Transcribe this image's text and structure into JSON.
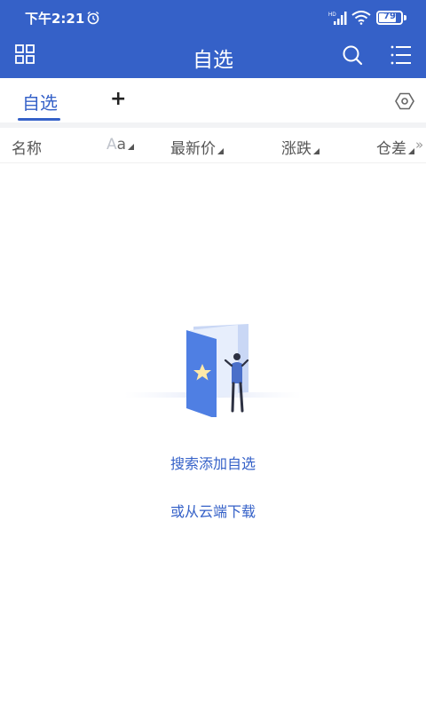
{
  "status": {
    "time": "下午2:21",
    "network": "HD",
    "battery": "79",
    "battery_level": 0.79
  },
  "header": {
    "title": "自选",
    "left_icon": "grid-icon",
    "right_icons": [
      "search-icon",
      "menu-list-icon"
    ]
  },
  "tabs": {
    "active": "自选",
    "add": "+",
    "settings_icon": "settings-hexagon-icon"
  },
  "columns": {
    "name": "名称",
    "aa_a": "A",
    "aa_b": "a",
    "price": "最新价",
    "change": "涨跌",
    "open_interest": "仓差",
    "more": "»"
  },
  "empty_state": {
    "search_add": "搜索添加自选",
    "cloud_download": "或从云端下载"
  },
  "colors": {
    "accent": "#3561c8",
    "header_bg": "#3561c8",
    "text_secondary": "#555555"
  }
}
